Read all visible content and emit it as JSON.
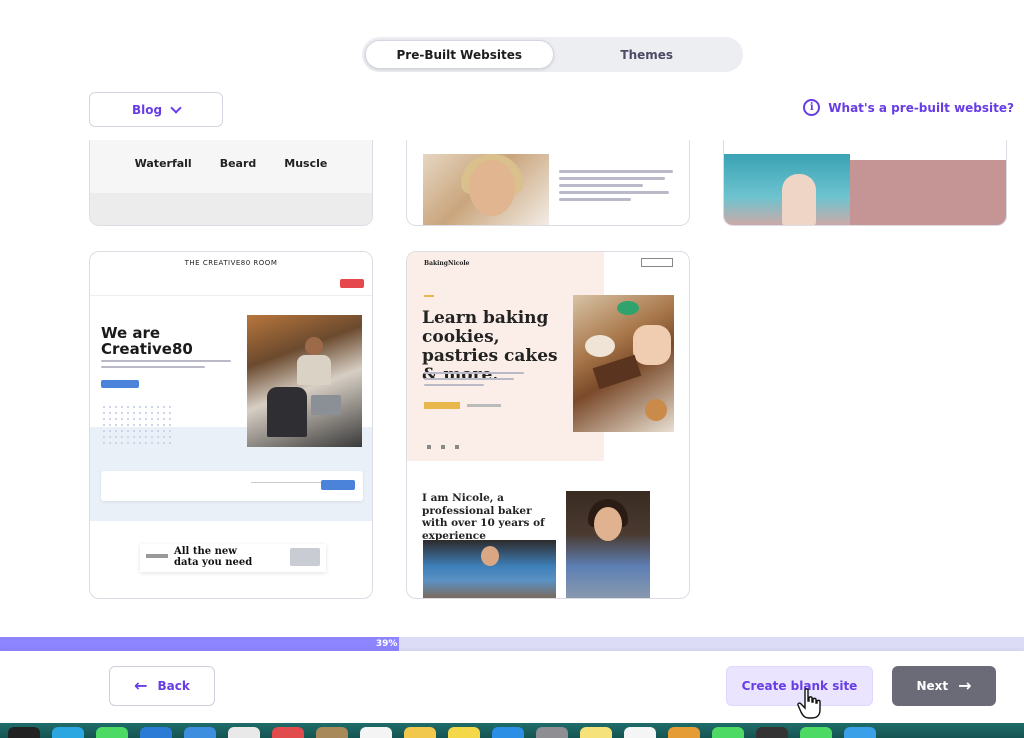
{
  "toggle": {
    "options": [
      "Pre-Built Websites",
      "Themes"
    ],
    "active": "Pre-Built Websites"
  },
  "filter": {
    "selected": "Blog"
  },
  "help_link": "What's a pre-built website?",
  "templates": {
    "top_row": {
      "card1_nav": [
        "Waterfall",
        "Beard",
        "Muscle"
      ]
    },
    "creative": {
      "header": "THE CREATIVE80 ROOM",
      "headline": "We are Creative80",
      "ad_text": "All the new data you need"
    },
    "baking": {
      "logo": "BakingNicole",
      "headline": "Learn baking cookies, pastries cakes & more.",
      "about": "I am Nicole, a professional baker with over 10 years of experience"
    }
  },
  "progress": {
    "value": 0.39,
    "label": "39%"
  },
  "footer": {
    "back_label": "Back",
    "blank_label": "Create blank site",
    "next_label": "Next"
  },
  "colors": {
    "accent": "#673de6",
    "progress_fill": "#8c85ff",
    "progress_track": "#dcdcf6",
    "next_button": "#6a6b77"
  }
}
